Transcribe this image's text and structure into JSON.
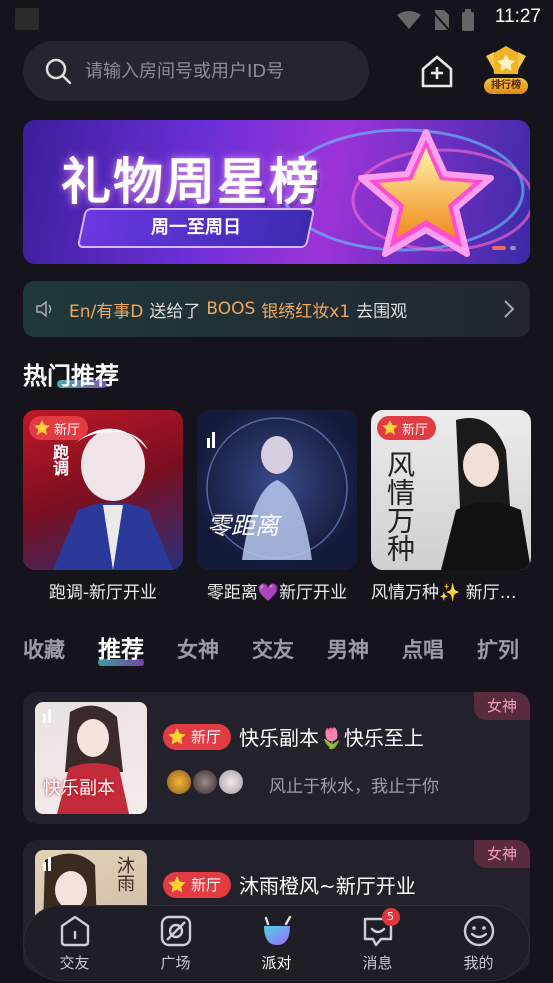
{
  "status": {
    "time": "11:27"
  },
  "search": {
    "placeholder": "请输入房间号或用户ID号"
  },
  "rank": {
    "label": "排行榜"
  },
  "banner": {
    "title": "礼物周星榜",
    "subtitle": "周一至周日"
  },
  "notice": {
    "user": "En/有事D",
    "action": "送给了",
    "target": "BOOS",
    "gift": "银绣红妆x1",
    "cta": "去围观"
  },
  "hot": {
    "title": "热门推荐",
    "items": [
      {
        "caption": "跑调-新厅开业",
        "badge": "新厅",
        "cover_text": "跑调"
      },
      {
        "caption": "零距离💜新厅开业",
        "badge": "",
        "cover_text": "零距离"
      },
      {
        "caption": "风情万种✨ 新厅开业",
        "badge": "新厅",
        "cover_text": "风情万种"
      }
    ]
  },
  "tabs": [
    "收藏",
    "推荐",
    "女神",
    "交友",
    "男神",
    "点唱",
    "扩列"
  ],
  "rooms": [
    {
      "tag": "女神",
      "badge": "新厅",
      "name": "快乐副本🌷快乐至上",
      "signature": "风止于秋水，我止于你",
      "cover_text": "快乐副本"
    },
    {
      "tag": "女神",
      "badge": "新厅",
      "name": "沐雨橙风~新厅开业",
      "signature": "",
      "cover_text": "沐雨"
    }
  ],
  "nav": [
    {
      "label": "交友",
      "icon": "home-icon"
    },
    {
      "label": "广场",
      "icon": "square-icon"
    },
    {
      "label": "派对",
      "icon": "party-icon"
    },
    {
      "label": "消息",
      "icon": "message-icon",
      "count": "5"
    },
    {
      "label": "我的",
      "icon": "profile-icon"
    }
  ],
  "colors": {
    "background": "#15131c",
    "accent_red": "#e23b42",
    "notice_orange": "#f2a860",
    "tag_pink": "#f4a0b8"
  }
}
